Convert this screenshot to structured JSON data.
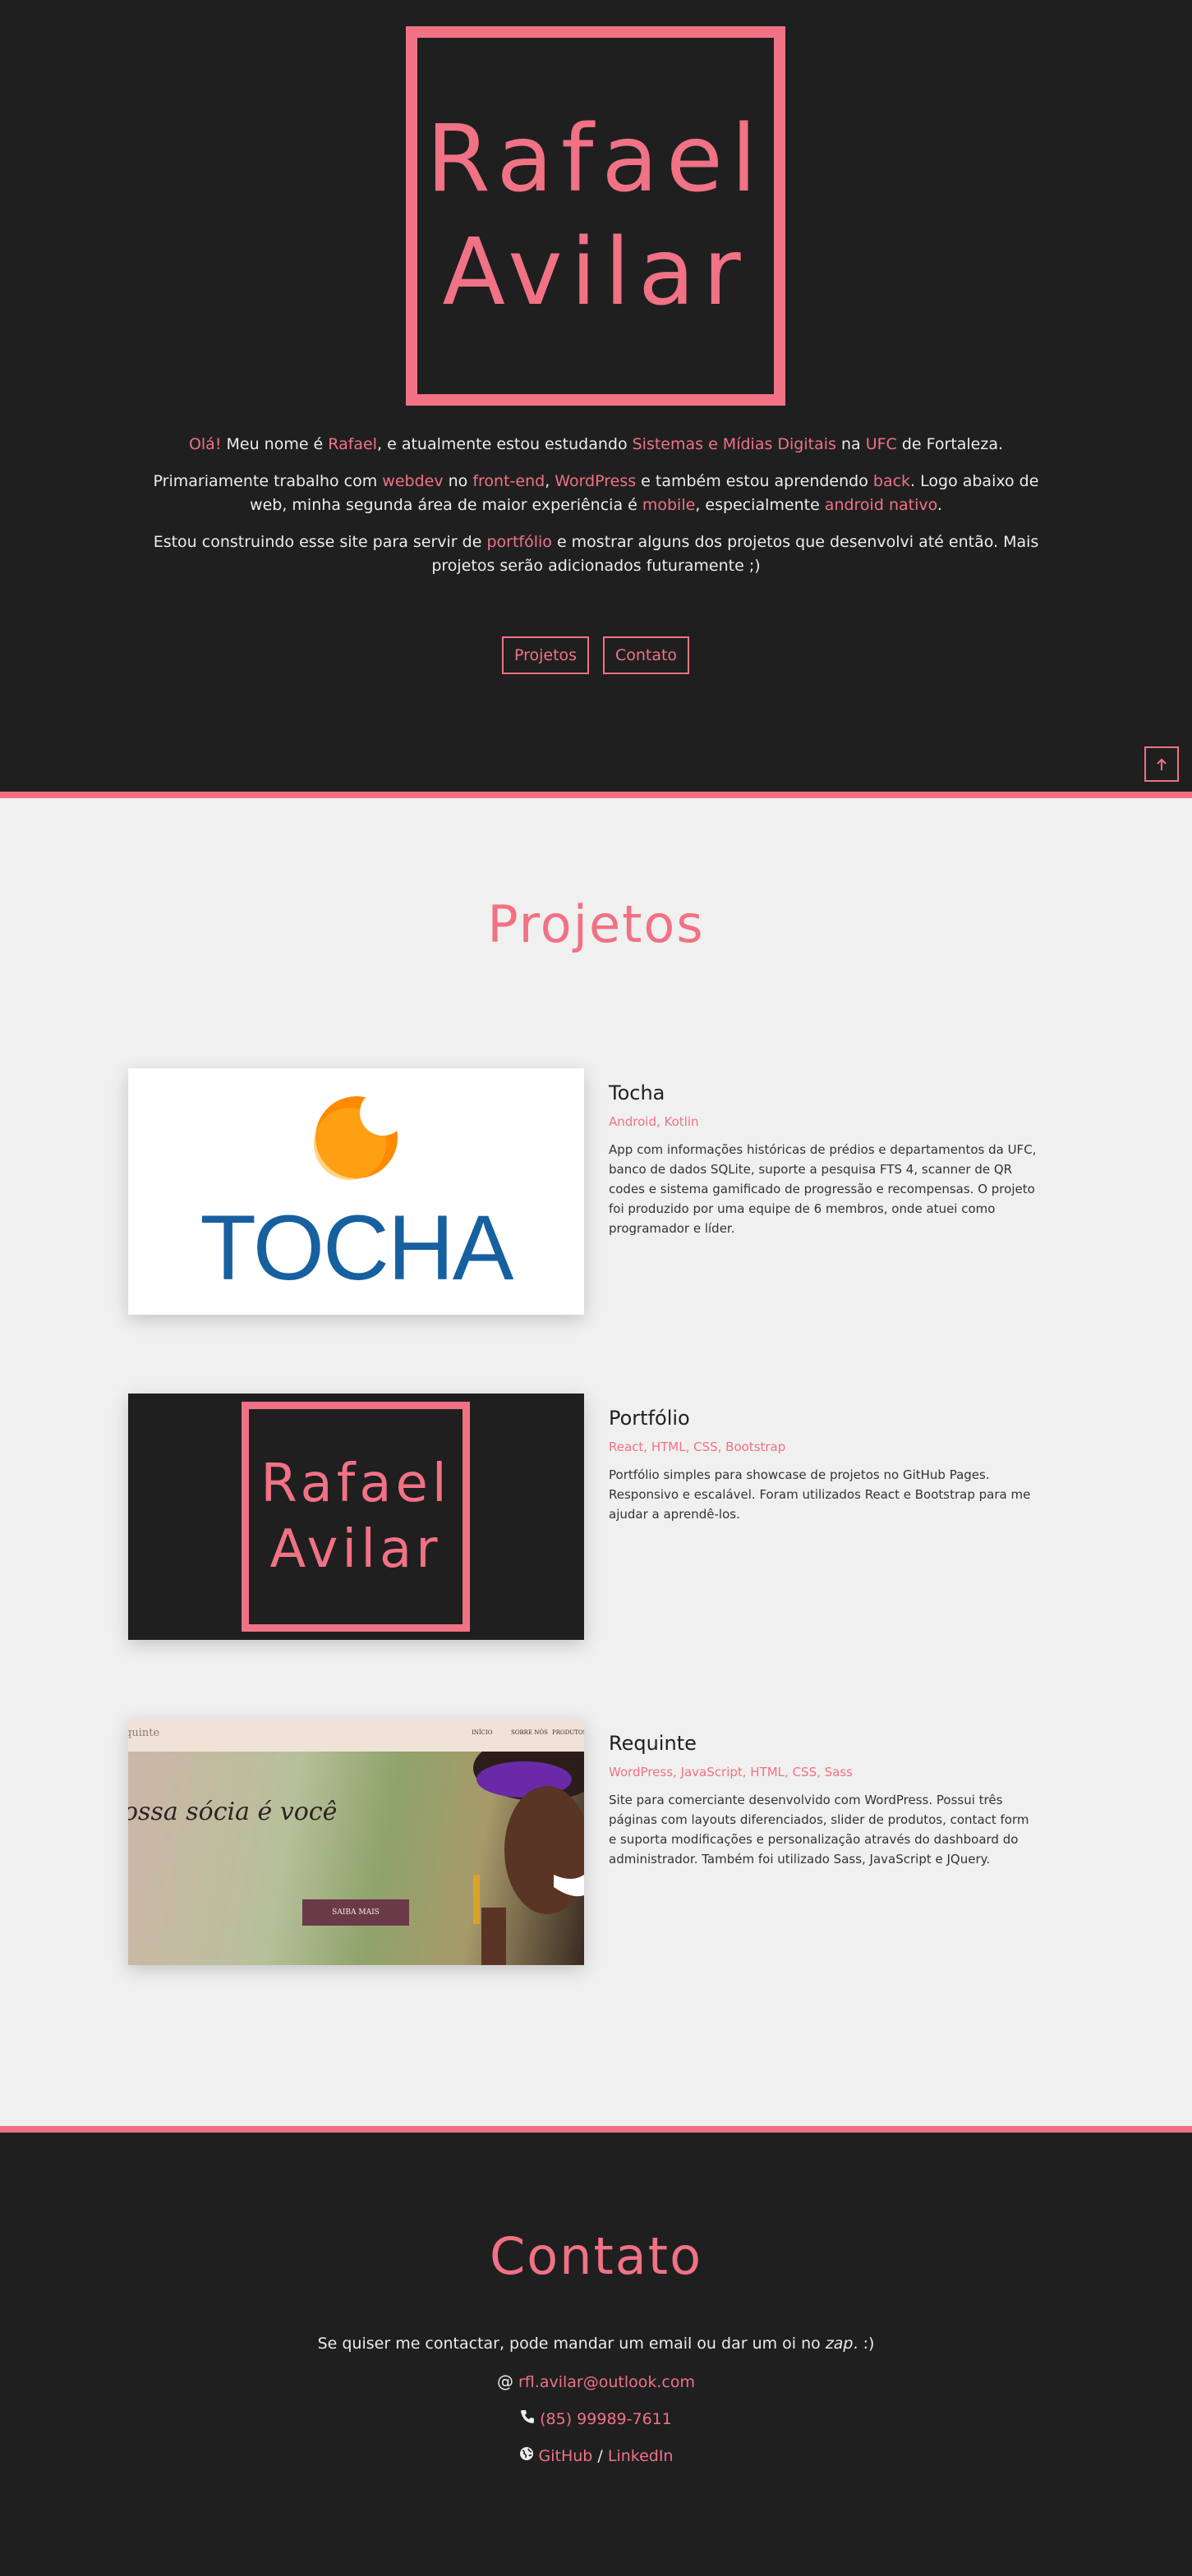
{
  "hero": {
    "logo_line1": "Rafael",
    "logo_line2": "Avilar",
    "p1": {
      "ola": "Olá!",
      "t1": " Meu nome é ",
      "rafael": "Rafael",
      "t2": ", e atualmente estou estudando ",
      "curso": "Sistemas e Mídias Digitais",
      "t3": " na ",
      "ufc": "UFC",
      "t4": " de Fortaleza."
    },
    "p2": {
      "t1": "Primariamente trabalho com ",
      "webdev": "webdev",
      "t2": " no ",
      "frontend": "front-end",
      "t3": ", ",
      "wordpress": "WordPress",
      "t4": " e também estou aprendendo ",
      "back": "back",
      "t5": ". Logo abaixo de web, minha segunda área de maior experiência é ",
      "mobile": "mobile",
      "t6": ", especialmente ",
      "android": "android nativo",
      "t7": "."
    },
    "p3": {
      "t1": "Estou construindo esse site para servir de ",
      "portfolio": "portfólio",
      "t2": " e mostrar alguns dos projetos que desenvolvi até então. Mais projetos serão adicionados futuramente ;)"
    },
    "btn_projetos": "Projetos",
    "btn_contato": "Contato",
    "to_top_icon": "arrow-up-icon"
  },
  "projetos": {
    "title": "Projetos",
    "items": [
      {
        "title": "Tocha",
        "tags": "Android, Kotlin",
        "desc": "App com informações históricas de prédios e departamentos da UFC, banco de dados SQLite, suporte a pesquisa FTS 4, scanner de QR codes e sistema gamificado de progressão e recompensas. O projeto foi produzido por uma equipe de 6 membros, onde atuei como programador e líder.",
        "image_word": "TOCHA"
      },
      {
        "title": "Portfólio",
        "tags": "React, HTML, CSS, Bootstrap",
        "desc": "Portfólio simples para showcase de projetos no GitHub Pages. Responsivo e escalável. Foram utilizados React e Bootstrap para me ajudar a aprendê-los.",
        "image_line1": "Rafael",
        "image_line2": "Avilar"
      },
      {
        "title": "Requinte",
        "tags": "WordPress, JavaScript, HTML, CSS, Sass",
        "desc": "Site para comerciante desenvolvido com WordPress. Possui três páginas com layouts diferenciados, slider de produtos, contact form e suporta modificações e personalização através do dashboard do administrador. Também foi utilizado Sass, JavaScript e JQuery.",
        "image_brand": "quinte",
        "image_nav": [
          "INÍCIO",
          "SOBRE NÓS",
          "PRODUTOS"
        ],
        "image_headline": "ossa sócia é você",
        "image_button": "SAIBA MAIS"
      }
    ]
  },
  "contato": {
    "title": "Contato",
    "intro_a": "Se quiser me contactar, pode mandar um email ou dar um oi no ",
    "intro_zap": "zap",
    "intro_b": ". :)",
    "email": "rfl.avilar@outlook.com",
    "phone": "(85) 99989-7611",
    "github": "GitHub",
    "sep": " / ",
    "linkedin": "LinkedIn",
    "icons": [
      "at-icon",
      "phone-icon",
      "globe-icon"
    ]
  },
  "colors": {
    "accent": "#f07284",
    "dark": "#1f1f20",
    "light": "#f0f0f0"
  }
}
